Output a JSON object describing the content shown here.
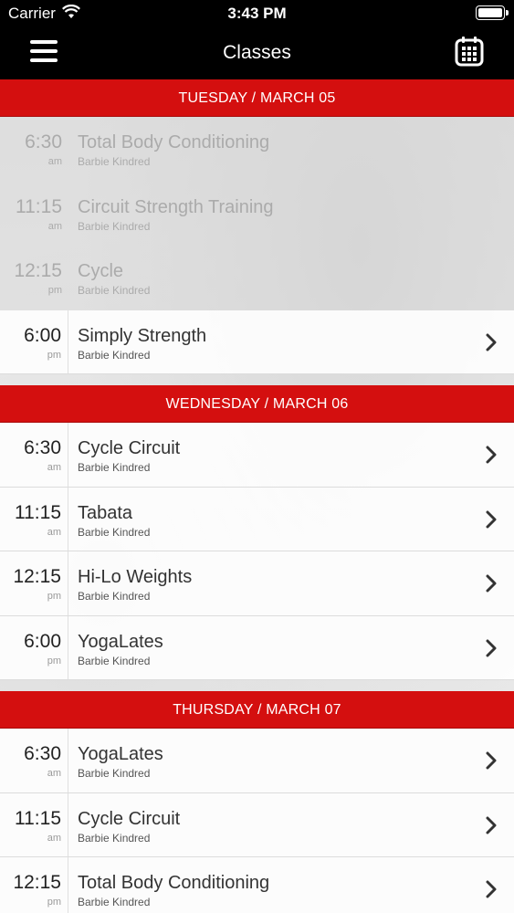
{
  "status_bar": {
    "carrier": "Carrier",
    "time": "3:43 PM"
  },
  "header": {
    "title": "Classes",
    "menu_icon": "hamburger-menu-icon",
    "calendar_icon": "calendar-icon"
  },
  "days": [
    {
      "label": "TUESDAY / MARCH 05",
      "classes": [
        {
          "time": "6:30",
          "ampm": "am",
          "name": "Total Body Conditioning",
          "instructor": "Barbie Kindred",
          "past": true
        },
        {
          "time": "11:15",
          "ampm": "am",
          "name": "Circuit Strength Training",
          "instructor": "Barbie Kindred",
          "past": true
        },
        {
          "time": "12:15",
          "ampm": "pm",
          "name": "Cycle",
          "instructor": "Barbie Kindred",
          "past": true
        },
        {
          "time": "6:00",
          "ampm": "pm",
          "name": "Simply Strength",
          "instructor": "Barbie Kindred",
          "past": false
        }
      ]
    },
    {
      "label": "WEDNESDAY / MARCH 06",
      "classes": [
        {
          "time": "6:30",
          "ampm": "am",
          "name": "Cycle Circuit",
          "instructor": "Barbie Kindred",
          "past": false
        },
        {
          "time": "11:15",
          "ampm": "am",
          "name": "Tabata",
          "instructor": "Barbie Kindred",
          "past": false
        },
        {
          "time": "12:15",
          "ampm": "pm",
          "name": "Hi-Lo Weights",
          "instructor": "Barbie Kindred",
          "past": false
        },
        {
          "time": "6:00",
          "ampm": "pm",
          "name": "YogaLates",
          "instructor": "Barbie Kindred",
          "past": false
        }
      ]
    },
    {
      "label": "THURSDAY / MARCH 07",
      "classes": [
        {
          "time": "6:30",
          "ampm": "am",
          "name": "YogaLates",
          "instructor": "Barbie Kindred",
          "past": false
        },
        {
          "time": "11:15",
          "ampm": "am",
          "name": "Cycle Circuit",
          "instructor": "Barbie Kindred",
          "past": false
        },
        {
          "time": "12:15",
          "ampm": "pm",
          "name": "Total Body Conditioning",
          "instructor": "Barbie Kindred",
          "past": false
        }
      ]
    }
  ],
  "colors": {
    "accent": "#d40f0f",
    "header_bg": "#000000"
  }
}
